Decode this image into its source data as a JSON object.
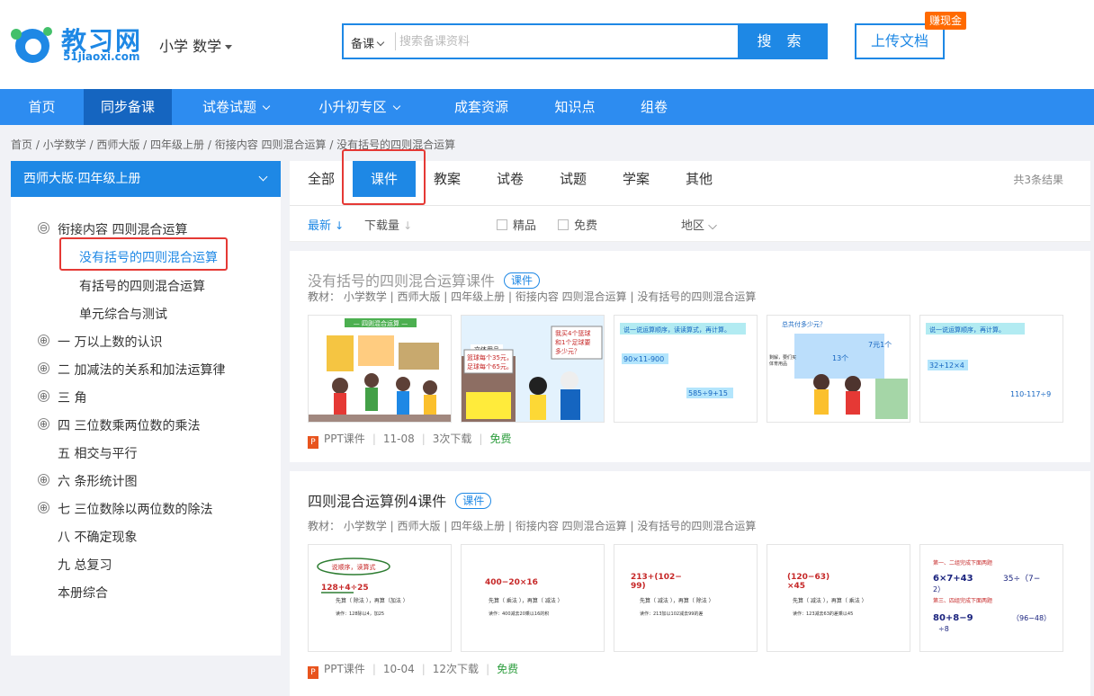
{
  "brand": {
    "name": "教习网",
    "domain": "51jiaoxi.com"
  },
  "subject_selector": "小学 数学",
  "search": {
    "type": "备课",
    "placeholder": "搜索备课资料",
    "button": "搜 索"
  },
  "upload_button": "上传文档",
  "cash_badge": "赚现金",
  "nav": [
    "首页",
    "同步备课",
    "试卷试题",
    "小升初专区",
    "成套资源",
    "知识点",
    "组卷"
  ],
  "breadcrumb": "首页 /  小学数学 / 西师大版 / 四年级上册 / 衔接内容 四则混合运算 / 没有括号的四则混合运算",
  "sidebar": {
    "header": "西师大版·四年级上册",
    "tree": [
      {
        "label": "衔接内容 四则混合运算",
        "icon": "⊖"
      },
      {
        "label": "没有括号的四则混合运算"
      },
      {
        "label": "有括号的四则混合运算"
      },
      {
        "label": "单元综合与测试"
      },
      {
        "label": "一 万以上数的认识",
        "icon": "⊕"
      },
      {
        "label": "二 加减法的关系和加法运算律",
        "icon": "⊕"
      },
      {
        "label": "三 角",
        "icon": "⊕"
      },
      {
        "label": "四 三位数乘两位数的乘法",
        "icon": "⊕"
      },
      {
        "label": "五 相交与平行"
      },
      {
        "label": "六 条形统计图",
        "icon": "⊕"
      },
      {
        "label": "七 三位数除以两位数的除法",
        "icon": "⊕"
      },
      {
        "label": "八 不确定现象"
      },
      {
        "label": "九 总复习"
      },
      {
        "label": "本册综合"
      }
    ]
  },
  "tabs": [
    "全部",
    "课件",
    "教案",
    "试卷",
    "试题",
    "学案",
    "其他"
  ],
  "result_count": "共3条结果",
  "filters": {
    "latest": "最新",
    "downloads": "下载量",
    "premium": "精品",
    "free": "免费",
    "region": "地区"
  },
  "results": [
    {
      "title": "没有括号的四则混合运算课件",
      "badge": "课件",
      "meta": "教材：  小学数学  |  西师大版  |  四年级上册  |  衔接内容 四则混合运算  |  没有括号的四则混合运算",
      "thumbs": [
        {
          "caption": "— 四则混合运算 —",
          "lines": []
        },
        {
          "caption": "文体用品",
          "lines": [
            "篮球每个35元，",
            "足球每个65元。",
            "我买4个篮球",
            "和1个足球要",
            "多少元？"
          ]
        },
        {
          "caption": "说一说运算顺序，读读算式，再计算。",
          "lines": [
            "90×11-900",
            "585÷9+15"
          ]
        },
        {
          "caption": "总共付多少元？",
          "lines": [
            "7元1个",
            "13个",
            "剩解，要们买",
            "体育用品"
          ]
        },
        {
          "caption": "说一说运算顺序，再计算。",
          "lines": [
            "32+12×4",
            "110-117÷9"
          ]
        }
      ],
      "file_type": "PPT课件",
      "date": "11-08",
      "downloads": "3次下载",
      "price": "免费"
    },
    {
      "title": "四则混合运算例4课件",
      "badge": "课件",
      "meta": "教材：  小学数学  |  西师大版  |  四年级上册  |  衔接内容 四则混合运算  |  没有括号的四则混合运算",
      "thumbs": [
        {
          "caption": "说顺序，读算式",
          "lines": [
            "128+4÷25",
            "先算（ 除法 ），再算（加法 ）",
            "读作：128除以4，加25"
          ]
        },
        {
          "caption": "",
          "lines": [
            "400−20×16",
            "先算（ 乘法 ），再算（ 减法 ）",
            "读作：400减去20乘以16的积"
          ]
        },
        {
          "caption": "",
          "lines": [
            "213+(102−",
            "99)",
            "先算（ 减法 ），再算（ 除法 ）",
            "读作：213加以102减去99的差"
          ]
        },
        {
          "caption": "",
          "lines": [
            "(120−63)",
            "×45",
            "先算（ 减法 ），再算（ 乘法 ）",
            "读作：123减去63的差乘以45"
          ]
        },
        {
          "caption": "第一、二组完成下面两题",
          "lines": [
            "6×7+43",
            "35÷（7−",
            "2）",
            "第三、四组完成下面两题",
            "80+8−9",
            "（96−48）",
            "÷8"
          ]
        }
      ],
      "file_type": "PPT课件",
      "date": "10-04",
      "downloads": "12次下载",
      "price": "免费"
    }
  ],
  "colors": {
    "primary": "#1e88e5",
    "nav": "#2d8cf0",
    "highlight": "#e53935",
    "free": "#2e9e3f",
    "cash": "#ff6a00"
  }
}
